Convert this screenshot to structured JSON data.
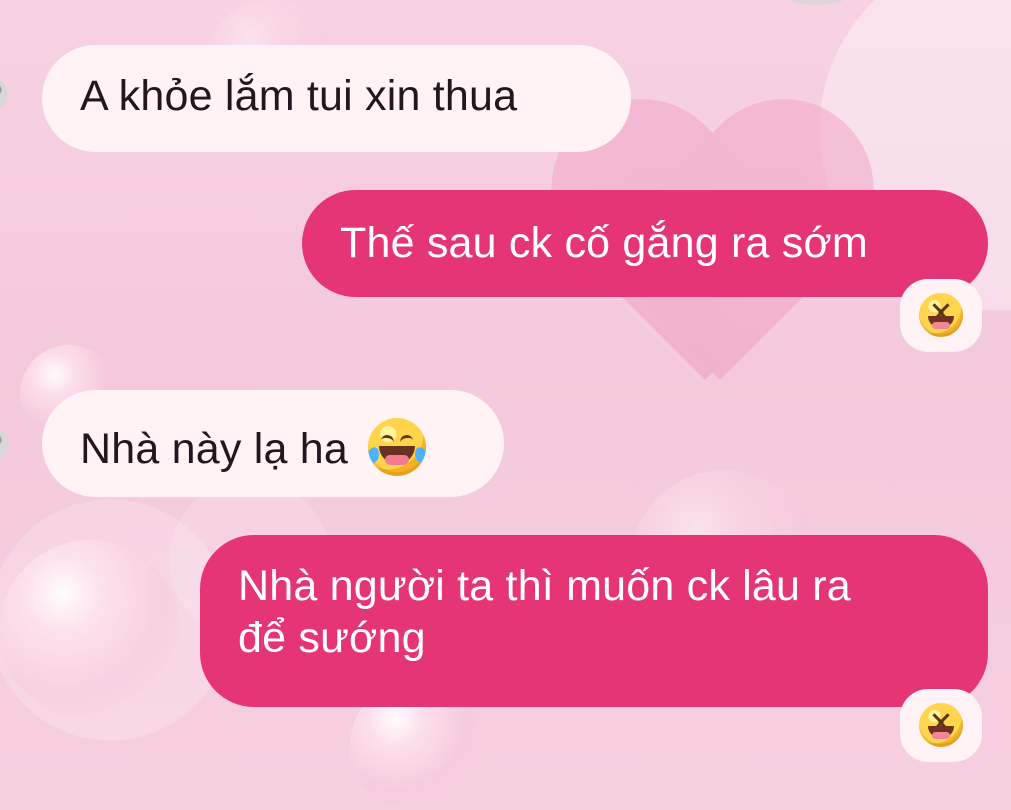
{
  "messages": [
    {
      "text": "A khỏe lắm tui xin thua"
    },
    {
      "text": "Thế sau ck cố gắng ra sớm"
    },
    {
      "text": "Nhà này lạ ha"
    },
    {
      "text": "Nhà người ta thì muốn ck lâu ra",
      "text2": "để sướng"
    }
  ],
  "icons": {
    "message3_emoji": "face-with-tears-of-joy-icon",
    "reaction_1": "grinning-squinting-face-icon",
    "reaction_2": "grinning-squinting-face-icon",
    "avatar_1": "avatar-icon",
    "avatar_2": "avatar-icon"
  },
  "colors": {
    "background": "#f6cfe0",
    "incoming_bubble": "#fff3f5",
    "incoming_text": "#26141f",
    "outgoing_bubble": "#e63577",
    "outgoing_text": "#ffffff"
  }
}
